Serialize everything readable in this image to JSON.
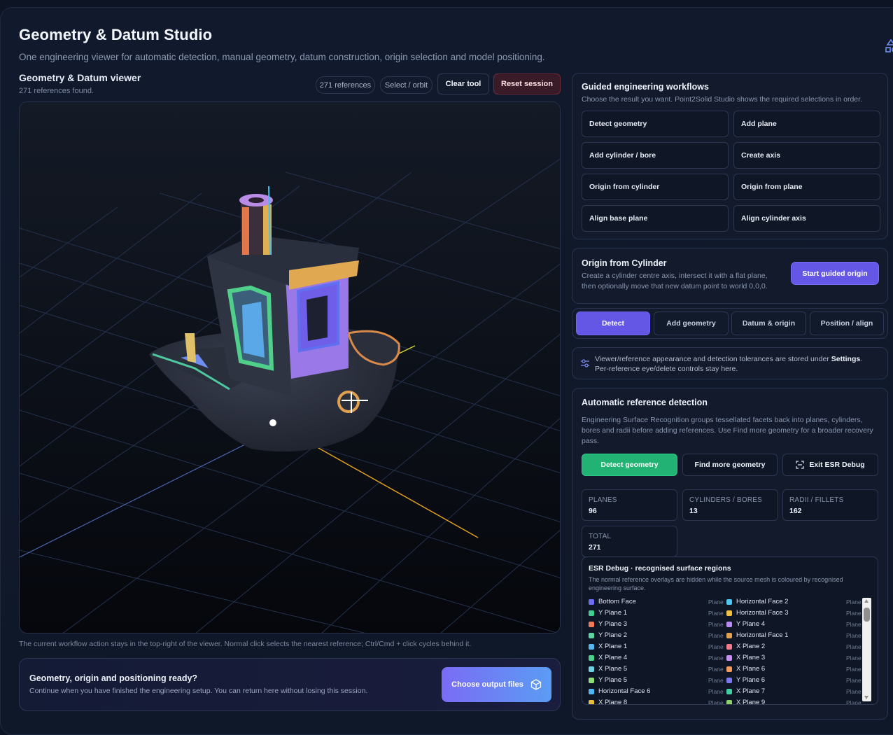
{
  "page": {
    "title": "Geometry & Datum Studio",
    "subtitle": "One engineering viewer for automatic detection, manual geometry, datum construction, origin selection and model positioning."
  },
  "viewer": {
    "title": "Geometry & Datum viewer",
    "found": "271 references found.",
    "ref_pill": "271 references",
    "mode_pill": "Select / orbit",
    "clear_tool": "Clear tool",
    "reset_session": "Reset session",
    "hint": "The current workflow action stays in the top-right of the viewer. Normal click selects the nearest reference; Ctrl/Cmd + click cycles behind it."
  },
  "ready": {
    "title": "Geometry, origin and positioning ready?",
    "subtitle": "Continue when you have finished the engineering setup. You can return here without losing this session.",
    "button": "Choose output files"
  },
  "workflows": {
    "title": "Guided engineering workflows",
    "subtitle": "Choose the result you want. Point2Solid Studio shows the required selections in order.",
    "buttons": [
      "Detect geometry",
      "Add plane",
      "Add cylinder / bore",
      "Create axis",
      "Origin from cylinder",
      "Origin from plane",
      "Align base plane",
      "Align cylinder axis"
    ]
  },
  "origin": {
    "title": "Origin from Cylinder",
    "line1": "Create a cylinder centre axis, intersect it with a flat plane,",
    "line2": "then optionally move that new datum point to world 0,0,0.",
    "button": "Start guided origin"
  },
  "tabs": [
    "Detect",
    "Add geometry",
    "Datum & origin",
    "Position / align"
  ],
  "settings_note": {
    "line1_a": "Viewer/reference appearance and detection tolerances are stored under ",
    "line1_b": "Settings",
    "line1_c": ".",
    "line2": "Per-reference eye/delete controls stay here."
  },
  "detection": {
    "title": "Automatic reference detection",
    "description": "Engineering Surface Recognition groups tessellated facets back into planes, cylinders, bores and radii before adding references. Use Find more geometry for a broader recovery pass.",
    "detect_button": "Detect geometry",
    "find_more_button": "Find more geometry",
    "exit_debug_button": "Exit ESR Debug",
    "stats": [
      {
        "label": "PLANES",
        "value": "96"
      },
      {
        "label": "CYLINDERS / BORES",
        "value": "13"
      },
      {
        "label": "RADII / FILLETS",
        "value": "162"
      },
      {
        "label": "TOTAL",
        "value": "271"
      }
    ]
  },
  "esr": {
    "title": "ESR Debug · recognised surface regions",
    "subtitle_1": "The normal reference overlays are hidden while the source mesh is coloured by recognised",
    "subtitle_2": "engineering surface.",
    "left": [
      {
        "name": "Bottom Face",
        "type": "Plane",
        "color": "#6f6cf0"
      },
      {
        "name": "Y Plane 1",
        "type": "Plane",
        "color": "#3fcf8e"
      },
      {
        "name": "Y Plane 3",
        "type": "Plane",
        "color": "#f07a5a"
      },
      {
        "name": "Y Plane 2",
        "type": "Plane",
        "color": "#5fd6a0"
      },
      {
        "name": "X Plane 1",
        "type": "Plane",
        "color": "#59b7f0"
      },
      {
        "name": "X Plane 4",
        "type": "Plane",
        "color": "#4fcf8a"
      },
      {
        "name": "X Plane 5",
        "type": "Plane",
        "color": "#6fd0e0"
      },
      {
        "name": "Y Plane 5",
        "type": "Plane",
        "color": "#8fdc7a"
      },
      {
        "name": "Horizontal Face 6",
        "type": "Plane",
        "color": "#4fb8f0"
      },
      {
        "name": "X Plane 8",
        "type": "Plane",
        "color": "#e8c040"
      }
    ],
    "right": [
      {
        "name": "Horizontal Face 2",
        "type": "Plane",
        "color": "#4fc8f0"
      },
      {
        "name": "Horizontal Face 3",
        "type": "Plane",
        "color": "#f0c040"
      },
      {
        "name": "Y Plane 4",
        "type": "Plane",
        "color": "#b98cf5"
      },
      {
        "name": "Horizontal Face 1",
        "type": "Plane",
        "color": "#e0a050"
      },
      {
        "name": "X Plane 2",
        "type": "Plane",
        "color": "#f07a8a"
      },
      {
        "name": "X Plane 3",
        "type": "Plane",
        "color": "#c890f0"
      },
      {
        "name": "X Plane 6",
        "type": "Plane",
        "color": "#f09a60"
      },
      {
        "name": "Y Plane 6",
        "type": "Plane",
        "color": "#7a78f0"
      },
      {
        "name": "X Plane 7",
        "type": "Plane",
        "color": "#40d0a0"
      },
      {
        "name": "X Plane 9",
        "type": "Plane",
        "color": "#8fd070"
      }
    ]
  }
}
